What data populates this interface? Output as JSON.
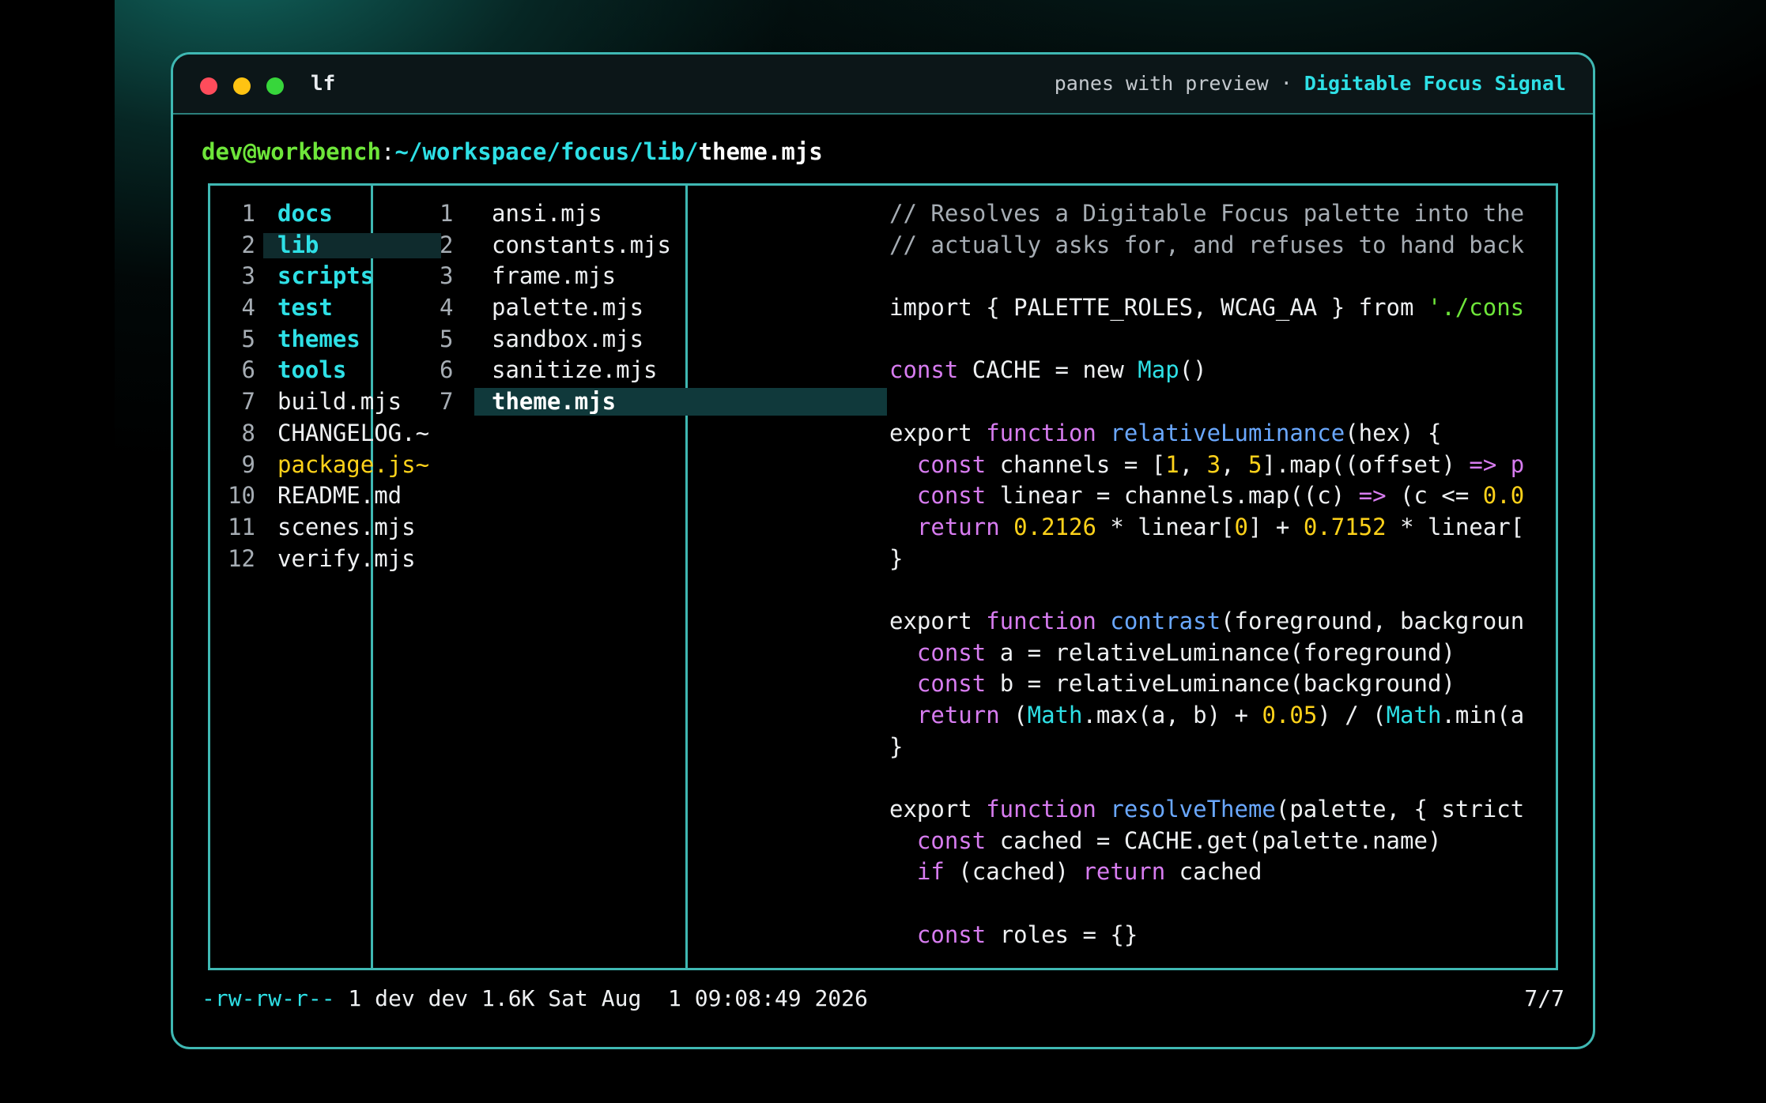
{
  "window": {
    "app_name": "lf",
    "subtitle": "panes with preview",
    "separator": "·",
    "brand": "Digitable Focus Signal"
  },
  "colors": {
    "accent": "#2ee0e6",
    "border": "#3fb8b3",
    "green": "#6ee63a",
    "yellow": "#ffd21a",
    "keyword": "#d77cf0",
    "function": "#6aa8ff"
  },
  "prompt": {
    "user": "dev@workbench",
    "colon": ":",
    "path": "~/workspace/focus/lib/",
    "file": "theme.mjs"
  },
  "parent_pane": {
    "items": [
      {
        "num": "1",
        "name": "docs",
        "type": "dir"
      },
      {
        "num": "2",
        "name": "lib",
        "type": "dir",
        "selected": true
      },
      {
        "num": "3",
        "name": "scripts",
        "type": "dir"
      },
      {
        "num": "4",
        "name": "test",
        "type": "dir"
      },
      {
        "num": "5",
        "name": "themes",
        "type": "dir"
      },
      {
        "num": "6",
        "name": "tools",
        "type": "dir"
      },
      {
        "num": "7",
        "name": "build.mjs",
        "type": "file"
      },
      {
        "num": "8",
        "name": "CHANGELOG.~",
        "type": "file"
      },
      {
        "num": "9",
        "name": "package.js~",
        "type": "json"
      },
      {
        "num": "10",
        "name": "README.md",
        "type": "file"
      },
      {
        "num": "11",
        "name": "scenes.mjs",
        "type": "file"
      },
      {
        "num": "12",
        "name": "verify.mjs",
        "type": "file"
      }
    ]
  },
  "current_pane": {
    "items": [
      {
        "num": "1",
        "name": "ansi.mjs"
      },
      {
        "num": "2",
        "name": "constants.mjs"
      },
      {
        "num": "3",
        "name": "frame.mjs"
      },
      {
        "num": "4",
        "name": "palette.mjs"
      },
      {
        "num": "5",
        "name": "sandbox.mjs"
      },
      {
        "num": "6",
        "name": "sanitize.mjs"
      },
      {
        "num": "7",
        "name": "theme.mjs",
        "selected": true
      }
    ]
  },
  "preview": {
    "lines": [
      [
        [
          "c-com",
          "// Resolves a Digitable Focus palette into the"
        ]
      ],
      [
        [
          "c-com",
          "// actually asks for, and refuses to hand back"
        ]
      ],
      [],
      [
        [
          "c-plain",
          "import { PALETTE_ROLES, WCAG_AA } from "
        ],
        [
          "c-str",
          "'./cons"
        ]
      ],
      [],
      [
        [
          "c-kw",
          "const"
        ],
        [
          "c-plain",
          " CACHE = new "
        ],
        [
          "c-cls",
          "Map"
        ],
        [
          "c-plain",
          "()"
        ]
      ],
      [],
      [
        [
          "c-plain",
          "export "
        ],
        [
          "c-kw",
          "function"
        ],
        [
          "c-plain",
          " "
        ],
        [
          "c-fn",
          "relativeLuminance"
        ],
        [
          "c-plain",
          "(hex) {"
        ]
      ],
      [
        [
          "c-plain",
          "  "
        ],
        [
          "c-kw",
          "const"
        ],
        [
          "c-plain",
          " channels = ["
        ],
        [
          "c-num",
          "1"
        ],
        [
          "c-plain",
          ", "
        ],
        [
          "c-num",
          "3"
        ],
        [
          "c-plain",
          ", "
        ],
        [
          "c-num",
          "5"
        ],
        [
          "c-plain",
          "].map((offset) "
        ],
        [
          "c-kw",
          "=>"
        ],
        [
          "c-plain",
          " "
        ],
        [
          "c-kw",
          "p"
        ]
      ],
      [
        [
          "c-plain",
          "  "
        ],
        [
          "c-kw",
          "const"
        ],
        [
          "c-plain",
          " linear = channels.map((c) "
        ],
        [
          "c-kw",
          "=>"
        ],
        [
          "c-plain",
          " (c <= "
        ],
        [
          "c-num",
          "0.0"
        ]
      ],
      [
        [
          "c-plain",
          "  "
        ],
        [
          "c-kw",
          "return"
        ],
        [
          "c-plain",
          " "
        ],
        [
          "c-num",
          "0.2126"
        ],
        [
          "c-plain",
          " * linear["
        ],
        [
          "c-num",
          "0"
        ],
        [
          "c-plain",
          "] + "
        ],
        [
          "c-num",
          "0.7152"
        ],
        [
          "c-plain",
          " * linear["
        ]
      ],
      [
        [
          "c-plain",
          "}"
        ]
      ],
      [],
      [
        [
          "c-plain",
          "export "
        ],
        [
          "c-kw",
          "function"
        ],
        [
          "c-plain",
          " "
        ],
        [
          "c-fn",
          "contrast"
        ],
        [
          "c-plain",
          "(foreground, backgroun"
        ]
      ],
      [
        [
          "c-plain",
          "  "
        ],
        [
          "c-kw",
          "const"
        ],
        [
          "c-plain",
          " a = relativeLuminance(foreground)"
        ]
      ],
      [
        [
          "c-plain",
          "  "
        ],
        [
          "c-kw",
          "const"
        ],
        [
          "c-plain",
          " b = relativeLuminance(background)"
        ]
      ],
      [
        [
          "c-plain",
          "  "
        ],
        [
          "c-kw",
          "return"
        ],
        [
          "c-plain",
          " ("
        ],
        [
          "c-cls",
          "Math"
        ],
        [
          "c-plain",
          ".max(a, b) + "
        ],
        [
          "c-num",
          "0.05"
        ],
        [
          "c-plain",
          ") / ("
        ],
        [
          "c-cls",
          "Math"
        ],
        [
          "c-plain",
          ".min(a"
        ]
      ],
      [
        [
          "c-plain",
          "}"
        ]
      ],
      [],
      [
        [
          "c-plain",
          "export "
        ],
        [
          "c-kw",
          "function"
        ],
        [
          "c-plain",
          " "
        ],
        [
          "c-fn",
          "resolveTheme"
        ],
        [
          "c-plain",
          "(palette, { strict"
        ]
      ],
      [
        [
          "c-plain",
          "  "
        ],
        [
          "c-kw",
          "const"
        ],
        [
          "c-plain",
          " cached = CACHE.get(palette.name)"
        ]
      ],
      [
        [
          "c-plain",
          "  "
        ],
        [
          "c-kw",
          "if"
        ],
        [
          "c-plain",
          " (cached) "
        ],
        [
          "c-kw",
          "return"
        ],
        [
          "c-plain",
          " cached"
        ]
      ],
      [],
      [
        [
          "c-plain",
          "  "
        ],
        [
          "c-kw",
          "const"
        ],
        [
          "c-plain",
          " roles = {}"
        ]
      ]
    ]
  },
  "status": {
    "permissions": "-rw-rw-r--",
    "details": " 1 dev dev 1.6K Sat Aug  1 09:08:49 2026",
    "position": "7/7"
  }
}
